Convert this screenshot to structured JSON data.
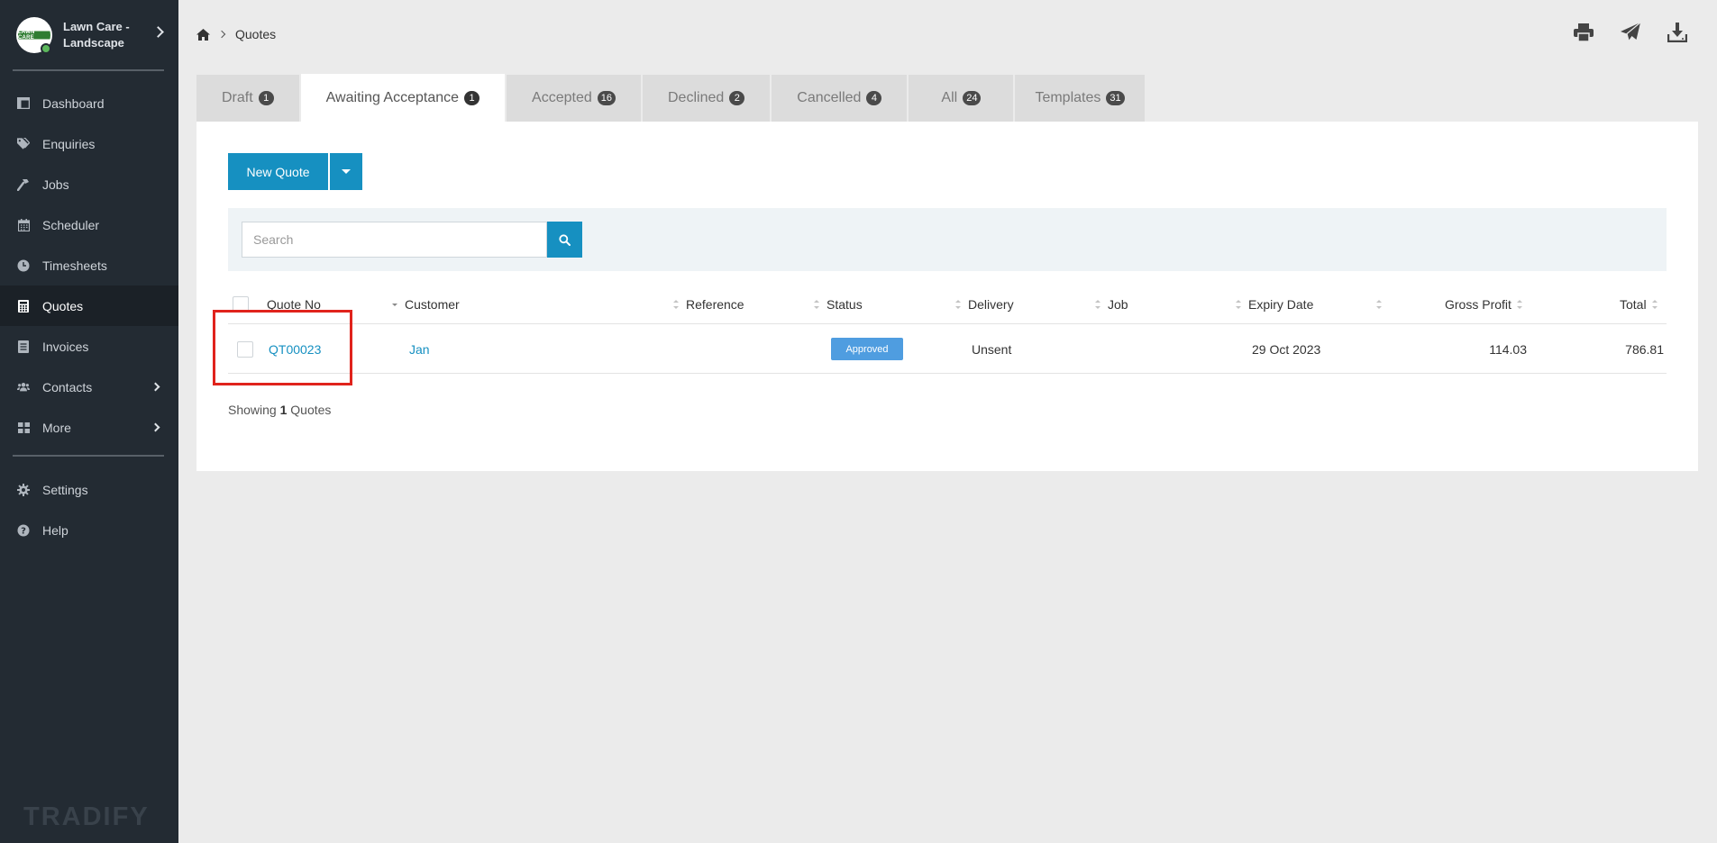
{
  "org": {
    "name": "Lawn Care - Landscape",
    "logo_text": "LAWN CARE"
  },
  "sidebar": {
    "items": [
      {
        "label": "Dashboard",
        "icon": "dashboard-icon",
        "active": false
      },
      {
        "label": "Enquiries",
        "icon": "tags-icon",
        "active": false
      },
      {
        "label": "Jobs",
        "icon": "hammer-icon",
        "active": false
      },
      {
        "label": "Scheduler",
        "icon": "calendar-icon",
        "active": false
      },
      {
        "label": "Timesheets",
        "icon": "clock-icon",
        "active": false
      },
      {
        "label": "Quotes",
        "icon": "calculator-icon",
        "active": true
      },
      {
        "label": "Invoices",
        "icon": "invoice-icon",
        "active": false
      },
      {
        "label": "Contacts",
        "icon": "users-icon",
        "active": false,
        "expandable": true
      },
      {
        "label": "More",
        "icon": "grid-icon",
        "active": false,
        "expandable": true
      }
    ],
    "bottom_items": [
      {
        "label": "Settings",
        "icon": "gear-icon"
      },
      {
        "label": "Help",
        "icon": "help-icon"
      }
    ],
    "brand": "TRADIFY"
  },
  "breadcrumb": {
    "current": "Quotes"
  },
  "tabs": [
    {
      "label": "Draft",
      "count": "1",
      "active": false
    },
    {
      "label": "Awaiting Acceptance",
      "count": "1",
      "active": true
    },
    {
      "label": "Accepted",
      "count": "16",
      "active": false
    },
    {
      "label": "Declined",
      "count": "2",
      "active": false
    },
    {
      "label": "Cancelled",
      "count": "4",
      "active": false
    },
    {
      "label": "All",
      "count": "24",
      "active": false
    },
    {
      "label": "Templates",
      "count": "31",
      "active": false
    }
  ],
  "toolbar": {
    "new_quote_label": "New Quote"
  },
  "search": {
    "placeholder": "Search",
    "value": ""
  },
  "table": {
    "columns": [
      "Quote No",
      "Customer",
      "Reference",
      "Status",
      "Delivery",
      "Job",
      "Expiry Date",
      "Gross Profit",
      "Total"
    ],
    "rows": [
      {
        "quote_no": "QT00023",
        "customer": "Jan",
        "reference": "",
        "status": "Approved",
        "delivery": "Unsent",
        "job": "",
        "expiry_date": "29 Oct 2023",
        "gross_profit": "114.03",
        "total": "786.81"
      }
    ]
  },
  "footer": {
    "showing_prefix": "Showing",
    "showing_count": "1",
    "showing_suffix": "Quotes"
  },
  "colors": {
    "sidebar": "#232b33",
    "accent": "#1690c1",
    "status_approved": "#4f9de0",
    "highlight": "#e0231c"
  }
}
